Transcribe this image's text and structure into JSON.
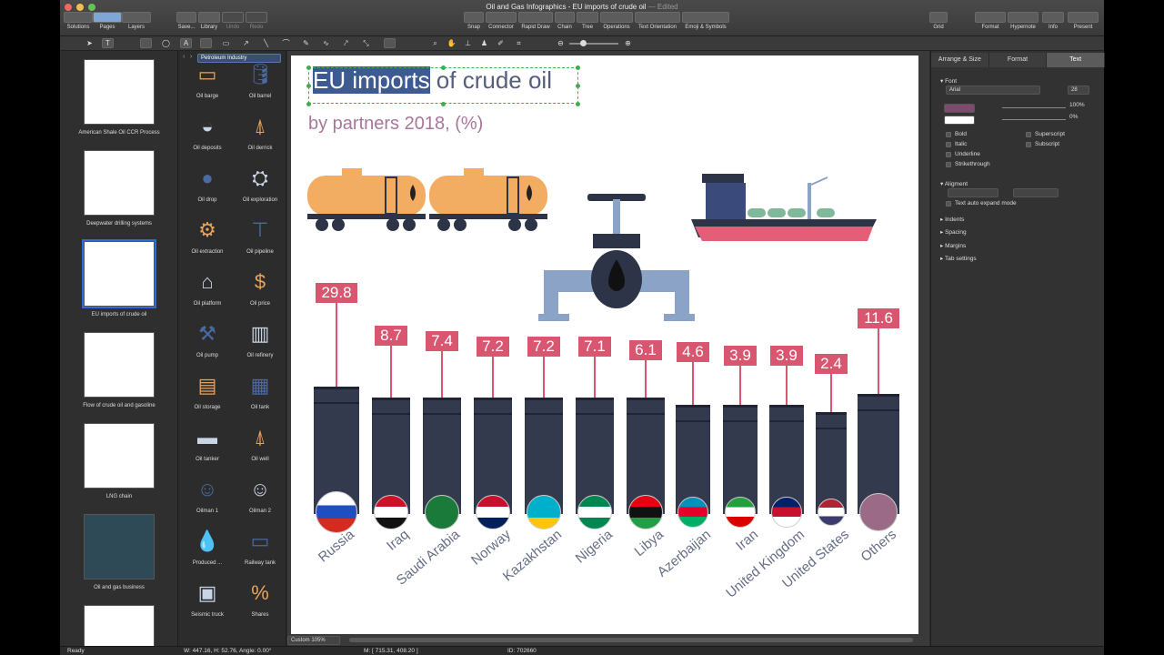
{
  "window": {
    "title": "Oil and Gas Infographics - EU imports of crude oil",
    "edited": "— Edited"
  },
  "toolbar": {
    "left": [
      "Solutions",
      "Pages",
      "Layers"
    ],
    "file": [
      "Save...",
      "Library",
      "Undo",
      "Redo"
    ],
    "center": [
      "Snap",
      "Connector",
      "Rapid Draw",
      "Chain",
      "Tree",
      "Operations",
      "Text Orientation",
      "Emoji & Symbols"
    ],
    "grid": "Grid",
    "right": [
      "Format",
      "Hypernote",
      "Info",
      "Present"
    ]
  },
  "pages": [
    {
      "label": "American Shale Oil CCR Process"
    },
    {
      "label": "Deepwater drilling systems"
    },
    {
      "label": "EU imports of crude oil",
      "selected": true
    },
    {
      "label": "Flow of crude oil and gasoline"
    },
    {
      "label": "LNG chain"
    },
    {
      "label": "Oil and gas business"
    }
  ],
  "library": {
    "category": "Petroleum Industry",
    "items": [
      {
        "label": "Oil barge",
        "icon": "barge-icon"
      },
      {
        "label": "Oil barrel",
        "icon": "barrel-icon"
      },
      {
        "label": "Oil deposits",
        "icon": "deposits-icon"
      },
      {
        "label": "Oil derrick",
        "icon": "derrick-icon"
      },
      {
        "label": "Oil drop",
        "icon": "drop-icon"
      },
      {
        "label": "Oil exploration",
        "icon": "exploration-icon"
      },
      {
        "label": "Oil extraction",
        "icon": "extraction-icon"
      },
      {
        "label": "Oil pipeline",
        "icon": "pipeline-icon"
      },
      {
        "label": "Oil platform",
        "icon": "platform-icon"
      },
      {
        "label": "Oil price",
        "icon": "price-icon"
      },
      {
        "label": "Oil pump",
        "icon": "pump-icon"
      },
      {
        "label": "Oil refinery",
        "icon": "refinery-icon"
      },
      {
        "label": "Oil storage",
        "icon": "storage-icon"
      },
      {
        "label": "Oil tank",
        "icon": "tank-icon"
      },
      {
        "label": "Oil tanker",
        "icon": "tanker-icon"
      },
      {
        "label": "Oil well",
        "icon": "well-icon"
      },
      {
        "label": "Oilman 1",
        "icon": "oilman-icon"
      },
      {
        "label": "Oilman 2",
        "icon": "oilman-icon"
      },
      {
        "label": "Produced ...",
        "icon": "produced-water-icon"
      },
      {
        "label": "Railway tank",
        "icon": "railway-tank-icon"
      },
      {
        "label": "Seismic truck",
        "icon": "seismic-truck-icon"
      },
      {
        "label": "Shares",
        "icon": "shares-icon"
      }
    ]
  },
  "inspector": {
    "tabs": [
      "Arrange & Size",
      "Format",
      "Text"
    ],
    "font_section": "Font",
    "font_name": "Arial",
    "font_size": "28",
    "opacity1": "100%",
    "opacity2": "0%",
    "text_color": "#7e4a6e",
    "checks": [
      "Bold",
      "Superscript",
      "Italic",
      "Subscript",
      "Underline",
      "Strikethrough"
    ],
    "alignment": "Aligment",
    "auto_expand": "Text auto expand mode",
    "collapsed": [
      "Indents",
      "Spacing",
      "Margins",
      "Tab settings"
    ]
  },
  "canvas": {
    "title_highlight": "EU imports",
    "title_rest": " of crude oil",
    "subtitle": "by partners 2018, (%)",
    "zoom": "Custom 105%"
  },
  "chart_data": {
    "type": "bar",
    "title": "EU imports of crude oil",
    "subtitle": "by partners 2018, (%)",
    "categories": [
      "Russia",
      "Iraq",
      "Saudi Arabia",
      "Norway",
      "Kazakhstan",
      "Nigeria",
      "Libya",
      "Azerbaijan",
      "Iran",
      "United Kingdom",
      "United States",
      "Others"
    ],
    "values": [
      29.8,
      8.7,
      7.4,
      7.2,
      7.2,
      7.1,
      6.1,
      4.6,
      3.9,
      3.9,
      2.4,
      11.6
    ],
    "value_labels": [
      "29.8",
      "8.7",
      "7.4",
      "7.2",
      "7.2",
      "7.1",
      "6.1",
      "4.6",
      "3.9",
      "3.9",
      "2.4",
      "11.6"
    ],
    "label_color": "#d8566f",
    "barrel_color": "#343a4d"
  },
  "status": {
    "ready": "Ready",
    "size": "W: 447.16,  H: 52.76,  Angle: 0.00°",
    "mouse": "M: [ 715.31, 408.20 ]",
    "id": "ID: 702660"
  }
}
